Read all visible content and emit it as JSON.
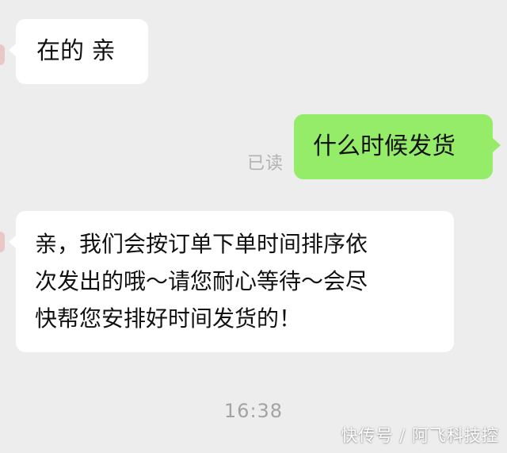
{
  "chat": {
    "messages": [
      {
        "side": "left",
        "text": "在的  亲"
      },
      {
        "side": "right",
        "text": "什么时候发货",
        "status": "已读"
      },
      {
        "side": "left",
        "lines": [
          "亲，我们会按订单下单时间排序依",
          "次发出的哦～请您耐心等待～会尽",
          "快帮您安排好时间发货的！"
        ]
      }
    ],
    "timestamp": "16:38"
  },
  "watermark": "快传号 / 阿飞科技控",
  "colors": {
    "background": "#ededed",
    "incoming_bubble": "#ffffff",
    "outgoing_bubble": "#95ec69",
    "status_text": "#b2b2b2"
  }
}
